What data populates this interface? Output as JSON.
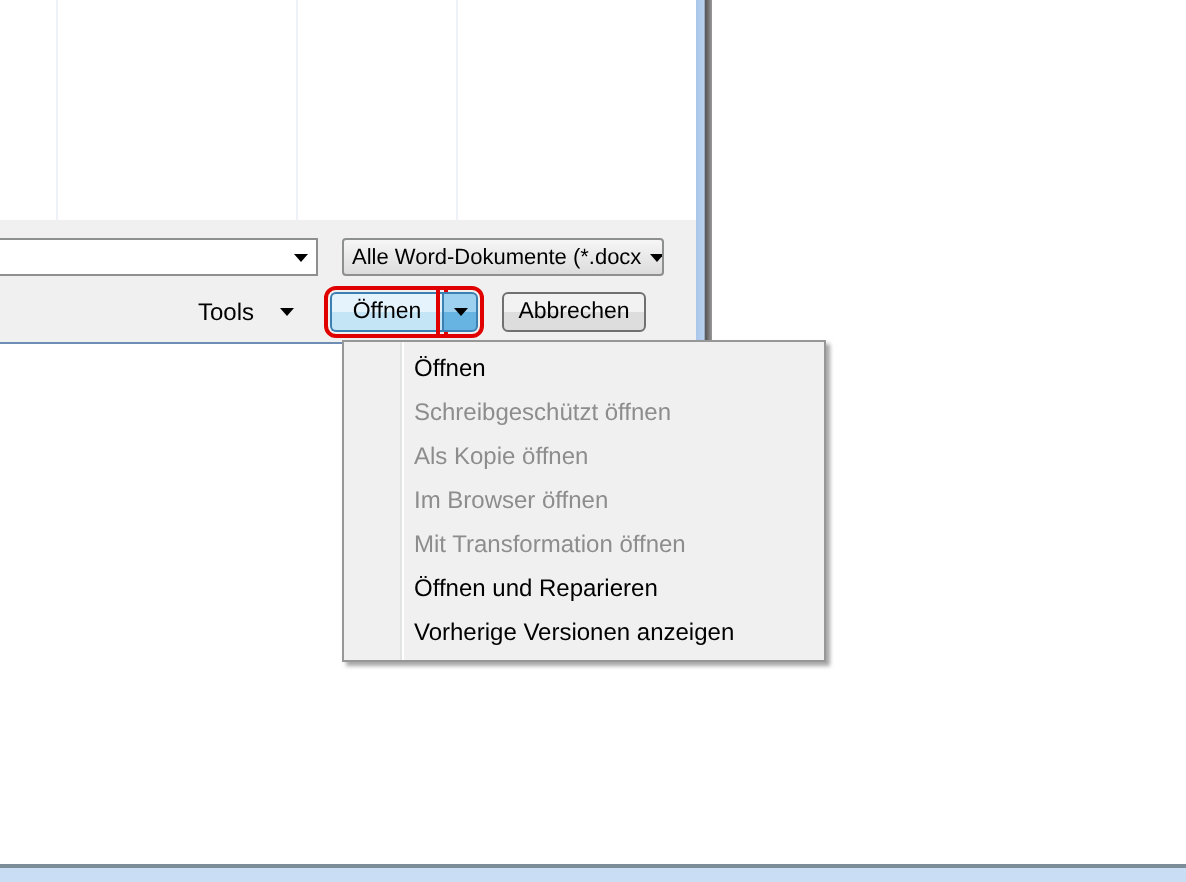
{
  "dialog": {
    "filter_dropdown": {
      "value": "Alle Word-Dokumente (*.docx"
    },
    "tools_button": {
      "label": "Tools"
    },
    "open_button": {
      "label": "Öffnen",
      "highlighted": true
    },
    "open_menu_arrow": {
      "highlighted": true
    },
    "cancel_button": {
      "label": "Abbrechen"
    }
  },
  "open_menu": {
    "items": [
      {
        "label": "Öffnen",
        "disabled": false
      },
      {
        "label": "Schreibgeschützt öffnen",
        "disabled": true
      },
      {
        "label": "Als Kopie öffnen",
        "disabled": true
      },
      {
        "label": "Im Browser öffnen",
        "disabled": true
      },
      {
        "label": "Mit Transformation öffnen",
        "disabled": true
      },
      {
        "label": "Öffnen und Reparieren",
        "disabled": false
      },
      {
        "label": "Vorherige Versionen anzeigen",
        "disabled": false
      }
    ]
  }
}
